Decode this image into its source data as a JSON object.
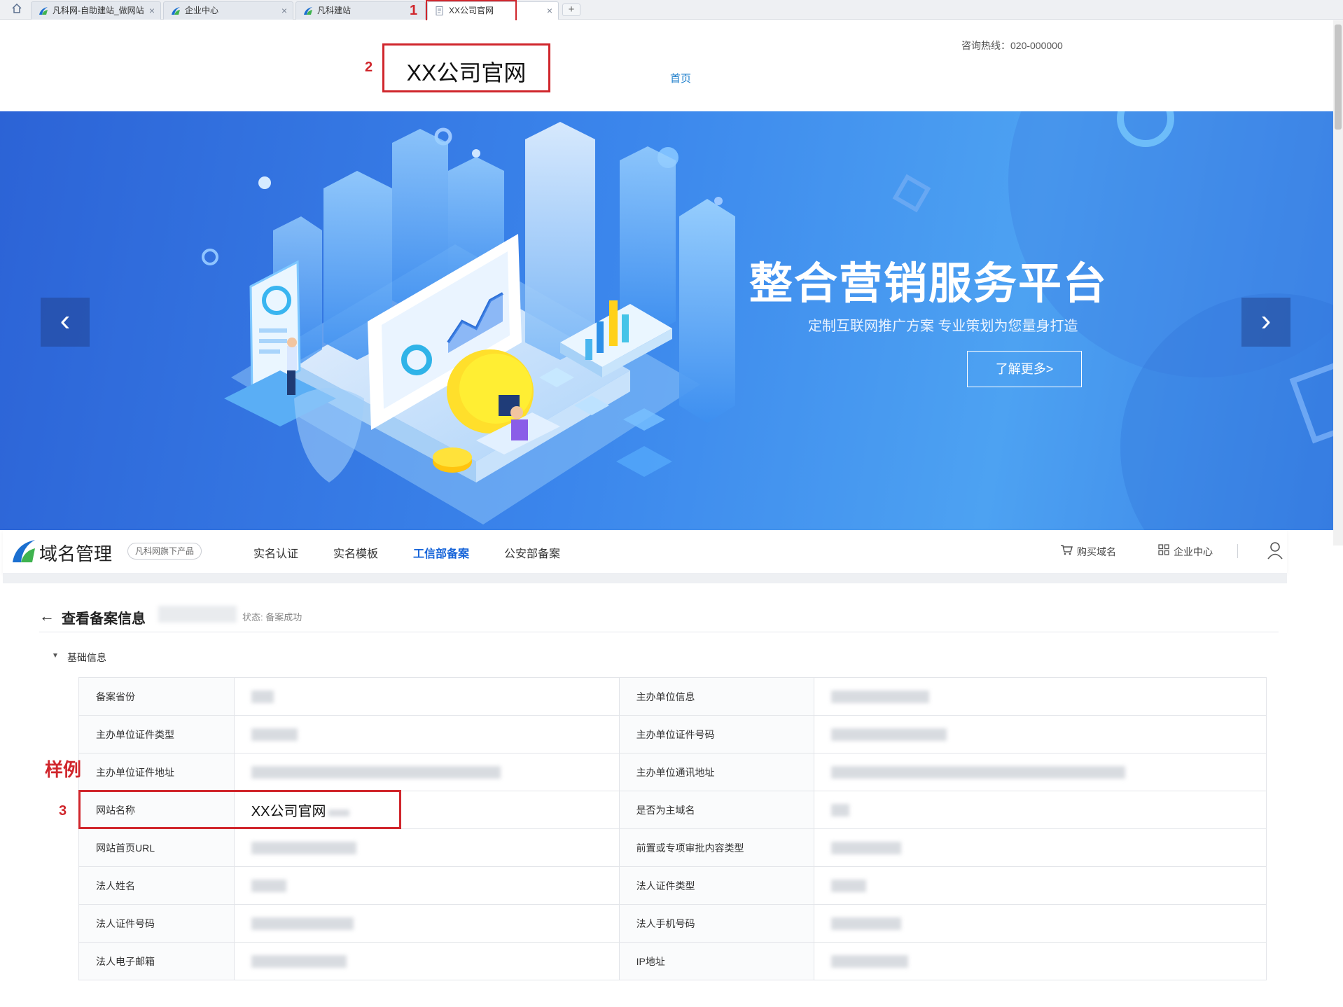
{
  "browser": {
    "tabs": [
      {
        "label": "凡科网-自助建站_做网站",
        "active": false,
        "closable": true
      },
      {
        "label": "企业中心",
        "active": false,
        "closable": true
      },
      {
        "label": "凡科建站",
        "active": false,
        "closable": false
      },
      {
        "label": "XX公司官网",
        "active": true,
        "closable": true
      }
    ],
    "new_tab": "+",
    "home_icon": "home-icon"
  },
  "annotations": {
    "n1": "1",
    "n2": "2",
    "n3": "3",
    "sample": "样例",
    "highlight_color": "#d0262c"
  },
  "site": {
    "hotline": "咨询热线：020-000000",
    "logo": "XX公司官网",
    "nav_home": "首页"
  },
  "banner": {
    "title": "整合营销服务平台",
    "subtitle": "定制互联网推广方案  专业策划为您量身打造",
    "button": "了解更多>",
    "prev": "‹",
    "next": "›"
  },
  "domain_panel": {
    "title": "域名管理",
    "badge": "凡科网旗下产品",
    "menu": [
      {
        "label": "实名认证",
        "active": false
      },
      {
        "label": "实名模板",
        "active": false
      },
      {
        "label": "工信部备案",
        "active": true
      },
      {
        "label": "公安部备案",
        "active": false
      }
    ],
    "buy_domain": "购买域名",
    "enterprise_center": "企业中心",
    "accent_color": "#1664d9",
    "detail": {
      "title": "查看备案信息",
      "status": "状态: 备案成功",
      "section": "基础信息",
      "rows": [
        {
          "l1": "备案省份",
          "l2": "主办单位信息"
        },
        {
          "l1": "主办单位证件类型",
          "l2": "主办单位证件号码"
        },
        {
          "l1": "主办单位证件地址",
          "l2": "主办单位通讯地址"
        },
        {
          "l1": "网站名称",
          "v1": "XX公司官网",
          "l2": "是否为主域名"
        },
        {
          "l1": "网站首页URL",
          "l2": "前置或专项审批内容类型"
        },
        {
          "l1": "法人姓名",
          "l2": "法人证件类型"
        },
        {
          "l1": "法人证件号码",
          "l2": "法人手机号码"
        },
        {
          "l1": "法人电子邮箱",
          "l2": "IP地址"
        }
      ]
    }
  }
}
